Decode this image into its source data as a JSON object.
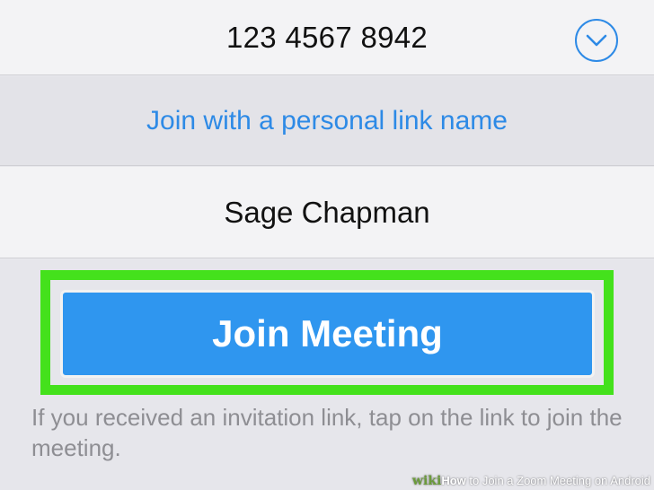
{
  "meeting": {
    "id": "123 4567 8942",
    "dropdown_icon": "chevron-down-icon"
  },
  "personal_link": {
    "label": "Join with a personal link name"
  },
  "name_field": {
    "value": "Sage Chapman"
  },
  "join_button": {
    "label": "Join Meeting"
  },
  "help": {
    "text": "If you received an invitation link, tap on the link to join the meeting."
  },
  "watermark": {
    "brand": "wiki",
    "how": "How",
    "rest": " to Join a Zoom Meeting on Android"
  },
  "colors": {
    "accent": "#2d8ae6",
    "button": "#2f96ef",
    "highlight": "#44e11c",
    "muted_text": "#8e8e93"
  }
}
